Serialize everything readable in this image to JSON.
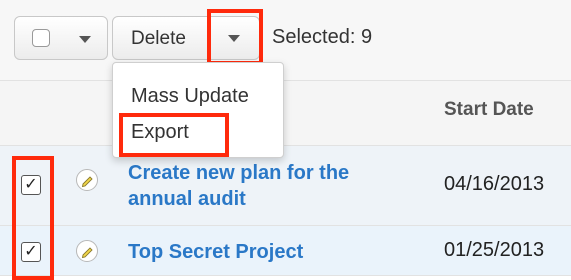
{
  "toolbar": {
    "delete_label": "Delete",
    "selected_label": "Selected: 9"
  },
  "table": {
    "columns": [
      "Start Date"
    ],
    "rows": [
      {
        "name": "Create new plan for the annual audit",
        "start_date": "04/16/2013",
        "checked": true
      },
      {
        "name": "Top Secret Project",
        "start_date": "01/25/2013",
        "checked": true
      }
    ]
  },
  "dropdown": {
    "items": [
      "Mass Update",
      "Export"
    ]
  },
  "icons": {
    "checkmark": "✓",
    "pencil": "✏"
  },
  "colors": {
    "highlight": "#ff2a0c",
    "link": "#2a78c7"
  }
}
